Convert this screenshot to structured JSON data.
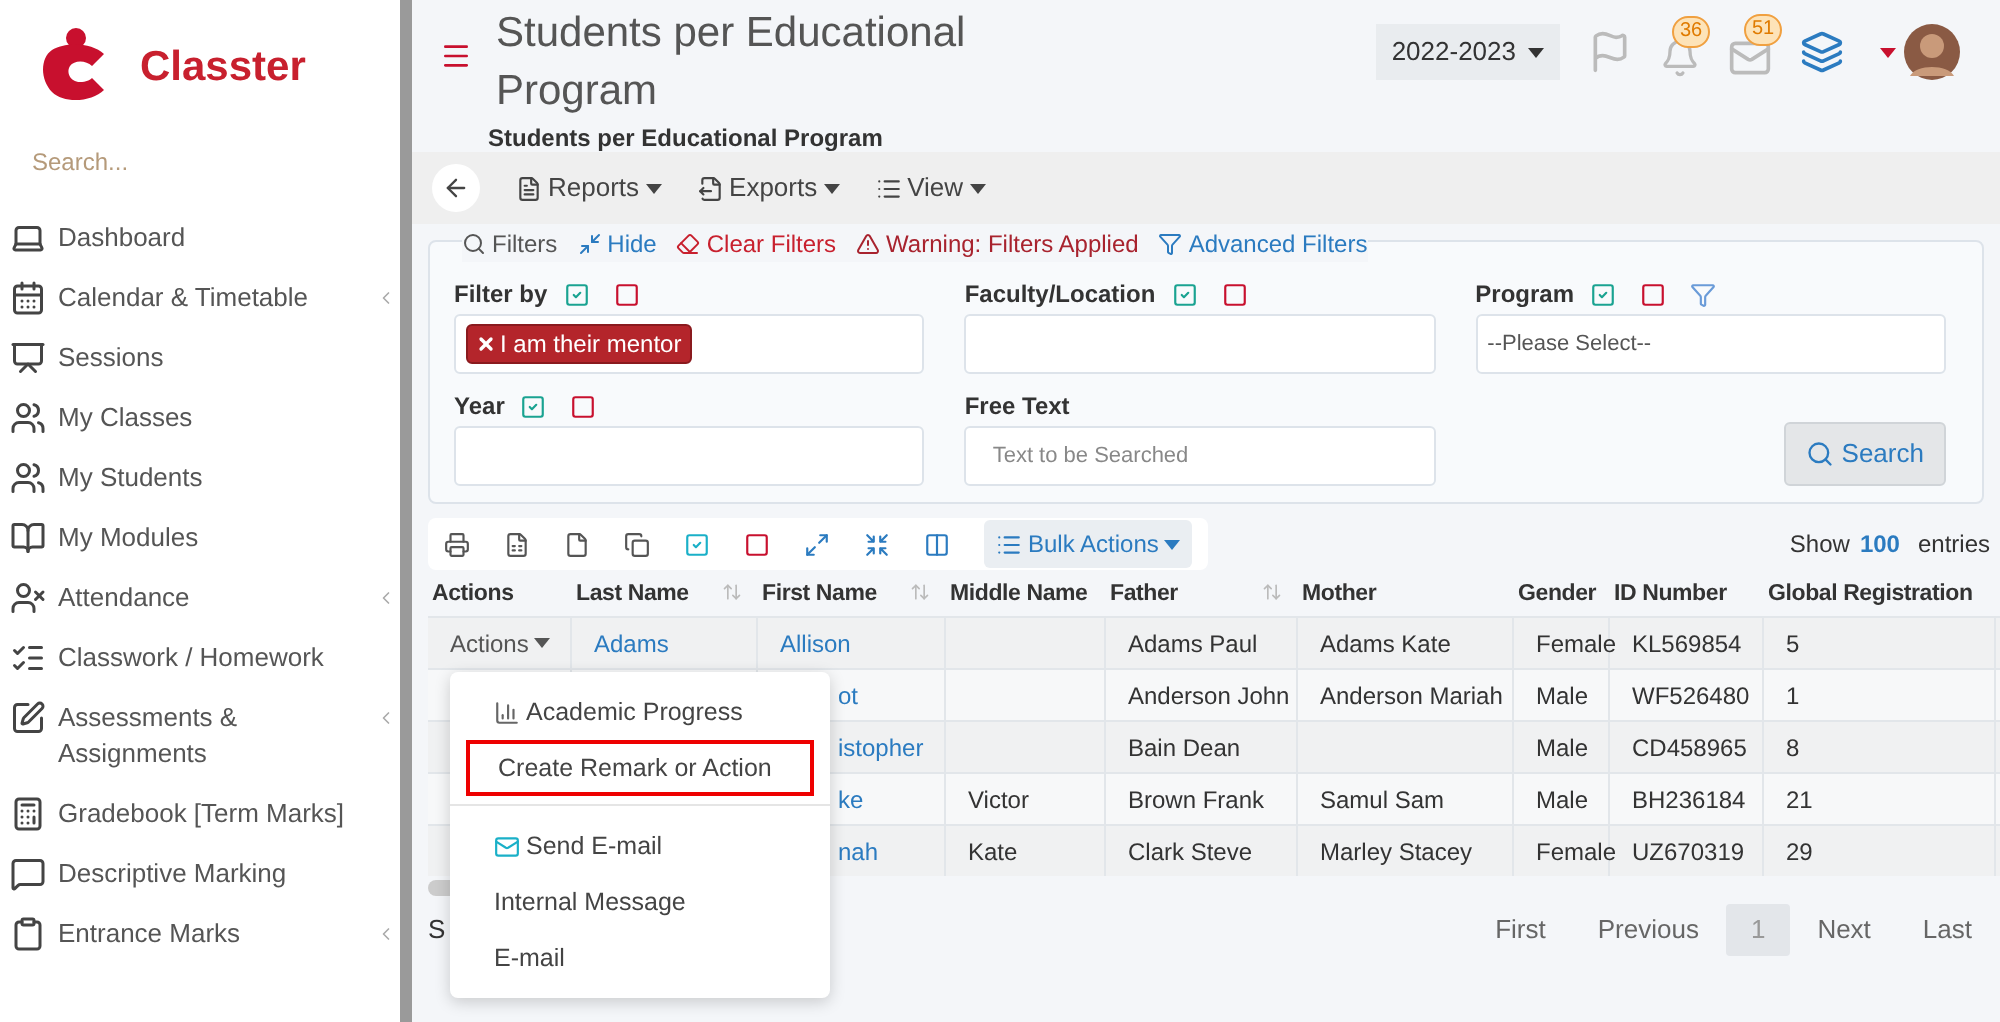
{
  "sidebar": {
    "brand": "Classter",
    "search": {
      "placeholder": "Search..."
    },
    "items": [
      {
        "label": "Dashboard",
        "expandable": false
      },
      {
        "label": "Calendar & Timetable",
        "expandable": true
      },
      {
        "label": "Sessions",
        "expandable": false
      },
      {
        "label": "My Classes",
        "expandable": false
      },
      {
        "label": "My Students",
        "expandable": false
      },
      {
        "label": "My Modules",
        "expandable": false
      },
      {
        "label": "Attendance",
        "expandable": true
      },
      {
        "label": "Classwork / Homework",
        "expandable": false
      },
      {
        "label": "Assessments & Assignments",
        "expandable": true
      },
      {
        "label": "Gradebook [Term Marks]",
        "expandable": false
      },
      {
        "label": "Descriptive Marking",
        "expandable": false
      },
      {
        "label": "Entrance Marks",
        "expandable": true
      }
    ]
  },
  "header": {
    "title": "Students per Educational Program",
    "subtitle": "Students per Educational Program",
    "year": "2022-2023",
    "notifications": "36",
    "messages": "51"
  },
  "toolbar": [
    "Reports",
    "Exports",
    "View"
  ],
  "filters": {
    "links": [
      {
        "label": "Filters",
        "kind": "plain"
      },
      {
        "label": "Hide",
        "kind": "link"
      },
      {
        "label": "Clear Filters",
        "kind": "danger"
      },
      {
        "label": "Warning: Filters Applied",
        "kind": "warning"
      },
      {
        "label": "Advanced Filters",
        "kind": "link"
      }
    ],
    "fields": [
      {
        "label": "Filter by",
        "kind": "select",
        "tags": [
          "I am their mentor"
        ]
      },
      {
        "label": "Faculty/Location",
        "kind": "select"
      },
      {
        "label": "Program",
        "kind": "select_advanced",
        "value": "--Please Select--"
      },
      {
        "label": "Year",
        "kind": "select"
      },
      {
        "label": "Free Text",
        "kind": "text",
        "placeholder": "Text to be Searched"
      }
    ],
    "search_button": "Search"
  },
  "table": {
    "bulk_actions": "Bulk Actions",
    "show": "Show",
    "page_size": "100",
    "entries": "entries",
    "columns": [
      "Actions",
      "Last Name",
      "First Name",
      "Middle Name",
      "Father",
      "Mother",
      "Gender",
      "ID Number",
      "Global Registration"
    ],
    "rows": [
      {
        "actions": "Actions",
        "last_name": "Adams",
        "first_name": "Allison",
        "father": "Adams Paul",
        "mother": "Adams Kate",
        "gender": "Female",
        "id": "KL569854",
        "global": "5"
      },
      {
        "first_name": "ot",
        "father": "Anderson John",
        "mother": "Anderson Mariah",
        "gender": "Male",
        "id": "WF526480",
        "global": "1"
      },
      {
        "first_name": "istopher",
        "father": "Bain Dean",
        "gender": "Male",
        "id": "CD458965",
        "global": "8"
      },
      {
        "first_name": "ke",
        "middle_name": "Victor",
        "father": "Brown Frank",
        "mother": "Samul Sam",
        "gender": "Male",
        "id": "BH236184",
        "global": "21"
      },
      {
        "first_name": "nah",
        "middle_name": "Kate",
        "father": "Clark Steve",
        "mother": "Marley Stacey",
        "gender": "Female",
        "id": "UZ670319",
        "global": "29"
      }
    ],
    "info": "S",
    "pagination": [
      {
        "label": "First",
        "selected": false
      },
      {
        "label": "Previous",
        "selected": false
      },
      {
        "label": "1",
        "selected": true
      },
      {
        "label": "Next",
        "selected": false
      },
      {
        "label": "Last",
        "selected": false
      }
    ]
  },
  "actions_menu": [
    {
      "label": "Academic Progress",
      "kind": "chart",
      "highlighted": false
    },
    {
      "label": "Create Remark or Action",
      "kind": "plain",
      "highlighted": true
    },
    {
      "label": "Send E-mail",
      "kind": "mail",
      "highlighted": false,
      "divider_before": true
    },
    {
      "label": "Internal Message",
      "kind": "plain",
      "highlighted": false
    },
    {
      "label": "E-mail",
      "kind": "plain",
      "highlighted": false
    }
  ]
}
